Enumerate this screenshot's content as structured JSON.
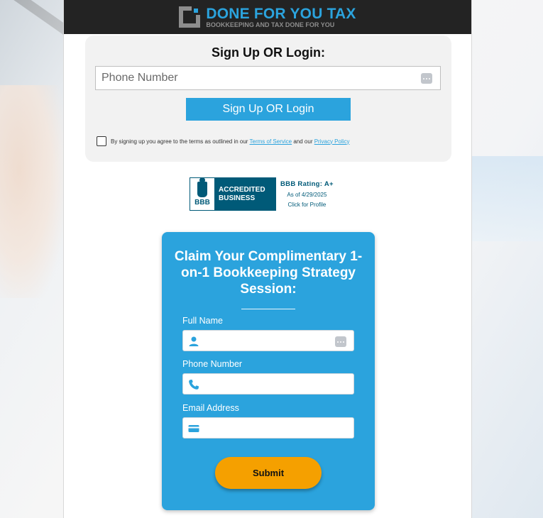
{
  "header": {
    "logo_title": "DONE FOR YOU TAX",
    "logo_subtitle": "BOOKKEEPING AND TAX DONE FOR YOU"
  },
  "login": {
    "title": "Sign Up OR Login:",
    "phone_placeholder": "Phone Number",
    "button_label": "Sign Up OR Login",
    "terms_prefix": "By signing up you agree to the terms as outlined in our",
    "terms_link": "Terms of Service",
    "terms_middle": "and our",
    "privacy_link": "Privacy Policy"
  },
  "bbb": {
    "letters": "BBB",
    "badge_line1": "ACCREDITED",
    "badge_line2": "BUSINESS",
    "rating": "BBB Rating: A+",
    "date": "As of 4/29/2025",
    "click": "Click for Profile"
  },
  "claim": {
    "title": "Claim Your Complimentary 1-on-1 Bookkeeping Strategy Session:",
    "full_name_label": "Full Name",
    "full_name_value": "",
    "phone_label": "Phone Number",
    "phone_value": "",
    "email_label": "Email Address",
    "email_value": "",
    "submit_label": "Submit"
  },
  "colors": {
    "accent": "#2ba3dd",
    "header_bg": "#232323",
    "submit": "#f5a000",
    "bbb_blue": "#005a78"
  }
}
